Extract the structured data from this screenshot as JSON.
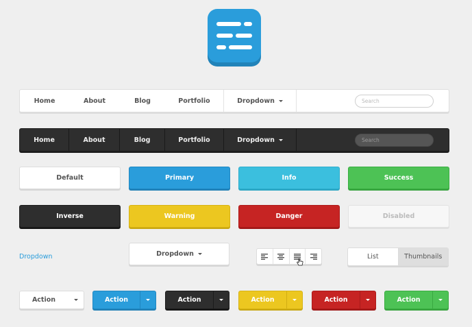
{
  "navbar_light": {
    "items": [
      "Home",
      "About",
      "Blog",
      "Portfolio",
      "Dropdown"
    ],
    "search_placeholder": "Search"
  },
  "navbar_dark": {
    "items": [
      "Home",
      "About",
      "Blog",
      "Portfolio",
      "Dropdown"
    ],
    "search_placeholder": "Search"
  },
  "buttons_row1": {
    "default": "Default",
    "primary": "Primary",
    "info": "Info",
    "success": "Success"
  },
  "buttons_row2": {
    "inverse": "Inverse",
    "warning": "Warning",
    "danger": "Danger",
    "disabled": "Disabled"
  },
  "dropdown_link": "Dropdown",
  "dropdown_button": "Dropdown",
  "align_group": [
    "align-left-icon",
    "align-center-icon",
    "align-justify-icon",
    "align-right-icon"
  ],
  "view_toggle": {
    "list": "List",
    "thumbnails": "Thumbnails",
    "selected": "Thumbnails"
  },
  "split_buttons": [
    "Action",
    "Action",
    "Action",
    "Action",
    "Action",
    "Action"
  ],
  "colors": {
    "primary": "#2a9ddb",
    "info": "#3bbfde",
    "success": "#4dc255",
    "inverse": "#2e2e2e",
    "warning": "#ecc720",
    "danger": "#c62423"
  }
}
